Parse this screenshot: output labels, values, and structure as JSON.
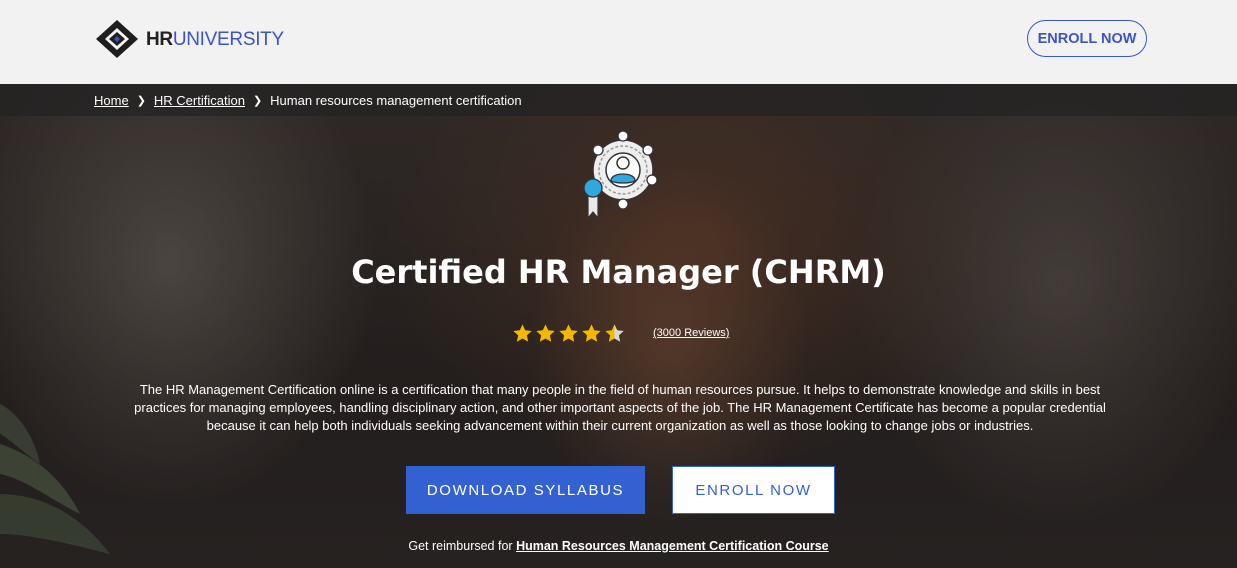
{
  "header": {
    "logo": {
      "hr": "HR",
      "university": "UNIVERSITY"
    },
    "enroll_button": "ENROLL NOW"
  },
  "breadcrumb": {
    "items": [
      "Home",
      "HR Certification",
      "Human resources management certification"
    ]
  },
  "hero": {
    "badge_icon": "certification-badge-icon",
    "title": "Certified HR Manager (CHRM)",
    "rating": {
      "stars": 4.5,
      "max": 5,
      "reviews_label": "(3000 Reviews)"
    },
    "description": "The HR Management Certification online is a certification that many people in the field of human resources pursue. It helps to demonstrate knowledge and skills in best practices for managing employees, handling disciplinary action, and other important aspects of the job. The HR Management Certificate has become a popular credential because it can help both individuals seeking advancement within their current organization as well as those looking to change jobs or industries.",
    "download_button": "DOWNLOAD SYLLABUS",
    "enroll_button": "ENROLL NOW",
    "reimburse_prefix": "Get reimbursed for",
    "reimburse_link": "Human Resources Management Certification Course"
  },
  "colors": {
    "accent": "#3461d1",
    "brand": "#3d54c4",
    "star": "#f5b800",
    "header_bg": "#f2f2f2"
  }
}
